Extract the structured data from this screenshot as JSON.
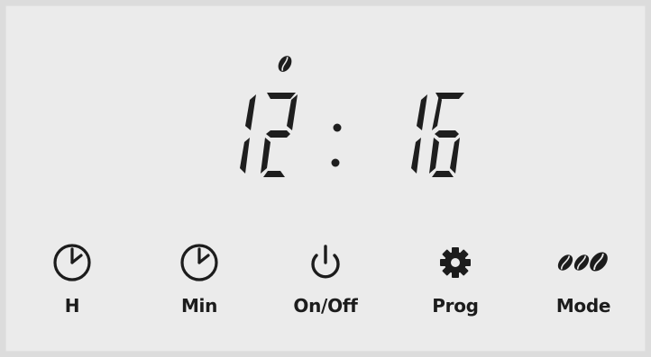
{
  "display": {
    "hours": [
      "1",
      "2"
    ],
    "minutes": [
      "1",
      "6"
    ],
    "colon": ":",
    "indicator_icon": "coffee-bean-icon",
    "segment_color": "#1e1e1e"
  },
  "buttons": [
    {
      "id": "h",
      "label": "H",
      "icon": "clock-icon"
    },
    {
      "id": "min",
      "label": "Min",
      "icon": "clock-icon"
    },
    {
      "id": "onoff",
      "label": "On/Off",
      "icon": "power-icon"
    },
    {
      "id": "prog",
      "label": "Prog",
      "icon": "gear-icon"
    },
    {
      "id": "mode",
      "label": "Mode",
      "icon": "three-coffee-beans-icon"
    }
  ]
}
